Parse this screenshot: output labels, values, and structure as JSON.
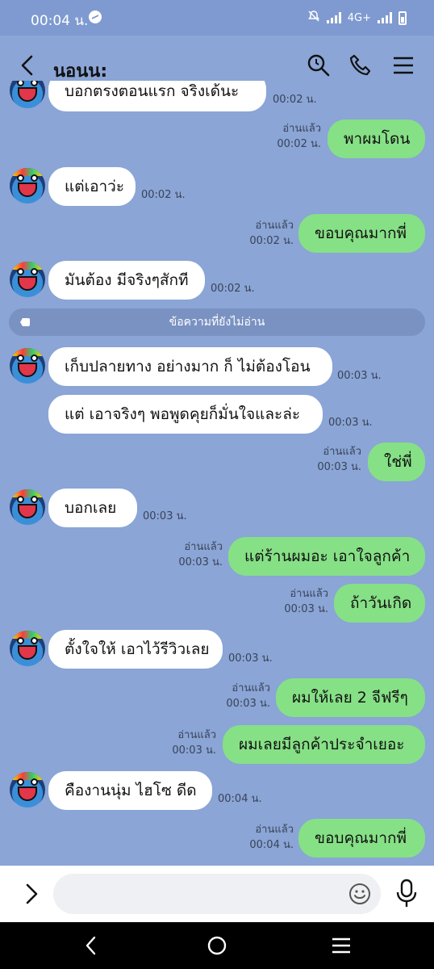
{
  "status_bar": {
    "time": "00:04 น.",
    "network": "4G+"
  },
  "header": {
    "title": "นอนน:",
    "icons": [
      "back-icon",
      "search-clock-icon",
      "phone-icon",
      "menu-icon"
    ]
  },
  "messages": [
    {
      "side": "in",
      "text": "บอกตรงตอนแรก จริงเด้นะ",
      "time": "00:02 น."
    },
    {
      "side": "out",
      "text": "พาผมโดน",
      "read": "อ่านแล้ว",
      "time": "00:02 น."
    },
    {
      "side": "in",
      "text": "แต่เอาว่ะ",
      "time": "00:02 น."
    },
    {
      "side": "out",
      "text": "ขอบคุณมากพี่",
      "read": "อ่านแล้ว",
      "time": "00:02 น."
    },
    {
      "side": "in",
      "text": "มันต้อง มีจริงๆสักที",
      "time": "00:02 น."
    },
    {
      "side": "in",
      "text": "เก็บปลายทาง อย่างมาก ก็ ไม่ต้องโอน",
      "time": "00:03 น."
    },
    {
      "side": "in",
      "text": "แต่ เอาจริงๆ พอพูดคุยก็มั่นใจและล่ะ",
      "time": "00:03 น."
    },
    {
      "side": "out",
      "text": "ใช่พี่",
      "read": "อ่านแล้ว",
      "time": "00:03 น."
    },
    {
      "side": "in",
      "text": "บอกเลย",
      "time": "00:03 น."
    },
    {
      "side": "out",
      "text": "แต่ร้านผมอะ เอาใจลูกค้า",
      "read": "อ่านแล้ว",
      "time": "00:03 น."
    },
    {
      "side": "out",
      "text": "ถ้าวันเกิด",
      "read": "อ่านแล้ว",
      "time": "00:03 น."
    },
    {
      "side": "in",
      "text": "ตั้งใจให้ เอาไว้รีวิวเลย",
      "time": "00:03 น."
    },
    {
      "side": "out",
      "text": "ผมให้เลย 2 จีฟรีๆ",
      "read": "อ่านแล้ว",
      "time": "00:03 น."
    },
    {
      "side": "out",
      "text": "ผมเลยมีลูกค้าประจำเยอะ",
      "read": "อ่านแล้ว",
      "time": "00:03 น."
    },
    {
      "side": "in",
      "text": "คืองานนุ่ม ไฮโซ ดีด",
      "time": "00:04 น."
    },
    {
      "side": "out",
      "text": "ขอบคุณมากพี่",
      "read": "อ่านแล้ว",
      "time": "00:04 น."
    }
  ],
  "unread_divider": "ข้อความที่ยังไม่อ่าน",
  "input": {
    "placeholder": ""
  },
  "colors": {
    "background": "#8aa5d6",
    "outgoing_bubble": "#86e086",
    "incoming_bubble": "#ffffff"
  }
}
